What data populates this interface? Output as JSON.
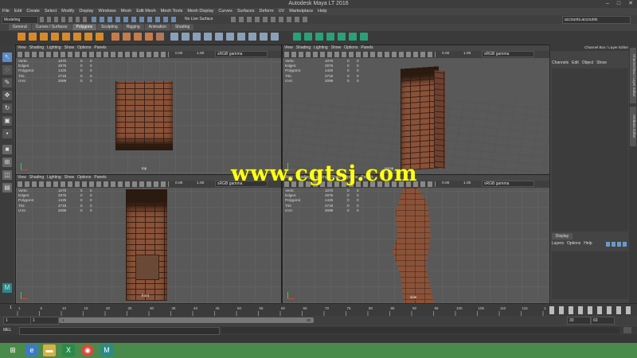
{
  "window": {
    "title": "Autodesk Maya LT 2016"
  },
  "menubar": [
    "File",
    "Edit",
    "Create",
    "Select",
    "Modify",
    "Display",
    "Windows",
    "Mesh",
    "Edit Mesh",
    "Mesh Tools",
    "Mesh Display",
    "Curves",
    "Surfaces",
    "Deform",
    "UV",
    "Marketplace",
    "Help"
  ],
  "statusline": {
    "mode": "Modeling",
    "live_surface": "No Live Surface",
    "account": "accounts.accounts"
  },
  "shelf_tabs": [
    "General",
    "Curves / Surfaces",
    "Polygons",
    "Sculpting",
    "Rigging",
    "Animation",
    "Shading"
  ],
  "active_shelf_tab": "Polygons",
  "viewport_menu": [
    "View",
    "Shading",
    "Lighting",
    "Show",
    "Options",
    "Panels"
  ],
  "viewport_tools": {
    "value_a": "0.00",
    "value_b": "1.00",
    "gamma": "sRGB gamma"
  },
  "hud": {
    "labels": [
      "Verts:",
      "Edges:",
      "Polygons:",
      "Tris:",
      "UVs:"
    ],
    "values": [
      "1070",
      "2975",
      "1425",
      "2718",
      "2099"
    ],
    "sel": [
      "0",
      "0",
      "0",
      "0",
      "0"
    ],
    "zero": [
      "0",
      "0",
      "0",
      "0",
      "0"
    ]
  },
  "viewports": {
    "top": "top",
    "persp": "persp",
    "front": "front",
    "side": "side"
  },
  "right_panel": {
    "header": "Channel Box / Layer Editor",
    "menu": [
      "Channels",
      "Edit",
      "Object",
      "Show"
    ],
    "display_tab": "Display",
    "layer_menu": [
      "Layers",
      "Options",
      "Help"
    ]
  },
  "side_tabs": [
    "Channel Box / Layer Editor",
    "Attribute Editor"
  ],
  "timeline": {
    "ticks": [
      "1",
      "5",
      "10",
      "15",
      "20",
      "25",
      "30",
      "35",
      "40",
      "45",
      "50",
      "55",
      "60",
      "65",
      "70",
      "75",
      "80",
      "85",
      "90",
      "95",
      "100",
      "105",
      "110",
      "115",
      "120"
    ],
    "current": "1"
  },
  "range": {
    "start": "1",
    "inner_start": "1",
    "inner_start_marker": "1",
    "inner_end": "30",
    "end": "30",
    "max": "60"
  },
  "mel": {
    "label": "MEL"
  },
  "watermark": "www.cgtsj.com",
  "colors": {
    "taskbar": "#4a8a4a",
    "watermark": "#ffff1a",
    "active_tab": "#6a6a6a"
  }
}
